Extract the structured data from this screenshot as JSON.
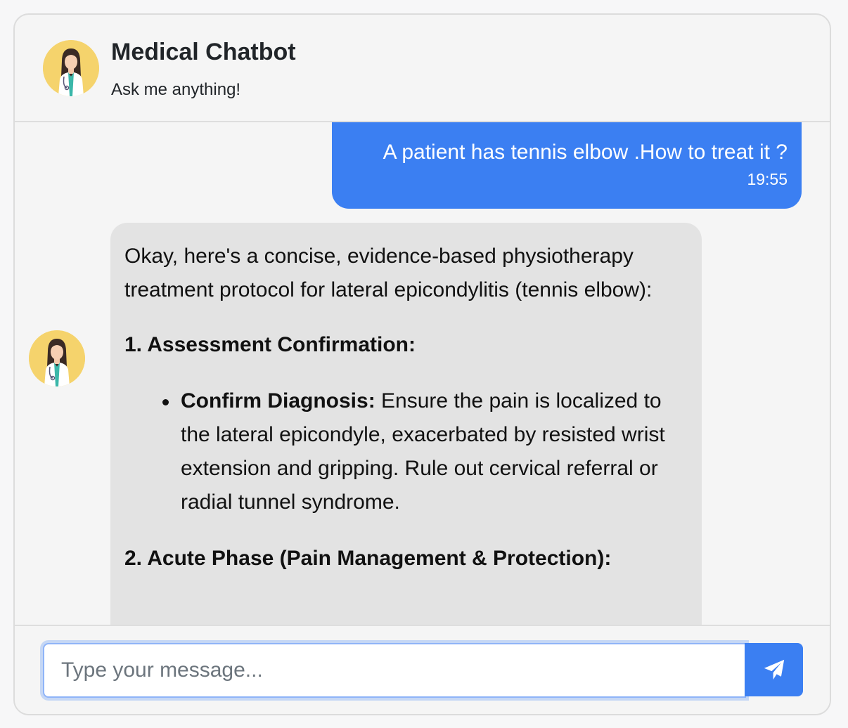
{
  "header": {
    "title": "Medical Chatbot",
    "subtitle": "Ask me anything!",
    "avatar_icon": "doctor-avatar-icon"
  },
  "messages": [
    {
      "role": "user",
      "text": "A patient has tennis elbow .How to treat it ?",
      "time": "19:55"
    },
    {
      "role": "bot",
      "intro": "Okay, here's a concise, evidence-based physiotherapy treatment protocol for lateral epicondylitis (tennis elbow):",
      "section1_heading": "1. Assessment Confirmation:",
      "bullet1_label": "Confirm Diagnosis:",
      "bullet1_text": " Ensure the pain is localized to the lateral epicondyle, exacerbated by resisted wrist extension and gripping. Rule out cervical referral or radial tunnel syndrome.",
      "section2_heading": "2. Acute Phase (Pain Management & Protection):"
    }
  ],
  "input": {
    "placeholder": "Type your message...",
    "value": ""
  },
  "send_button": {
    "icon": "send-icon"
  },
  "colors": {
    "accent": "#3b7ff2",
    "bot_bubble": "#e3e3e3",
    "avatar_bg": "#f5d36c"
  }
}
